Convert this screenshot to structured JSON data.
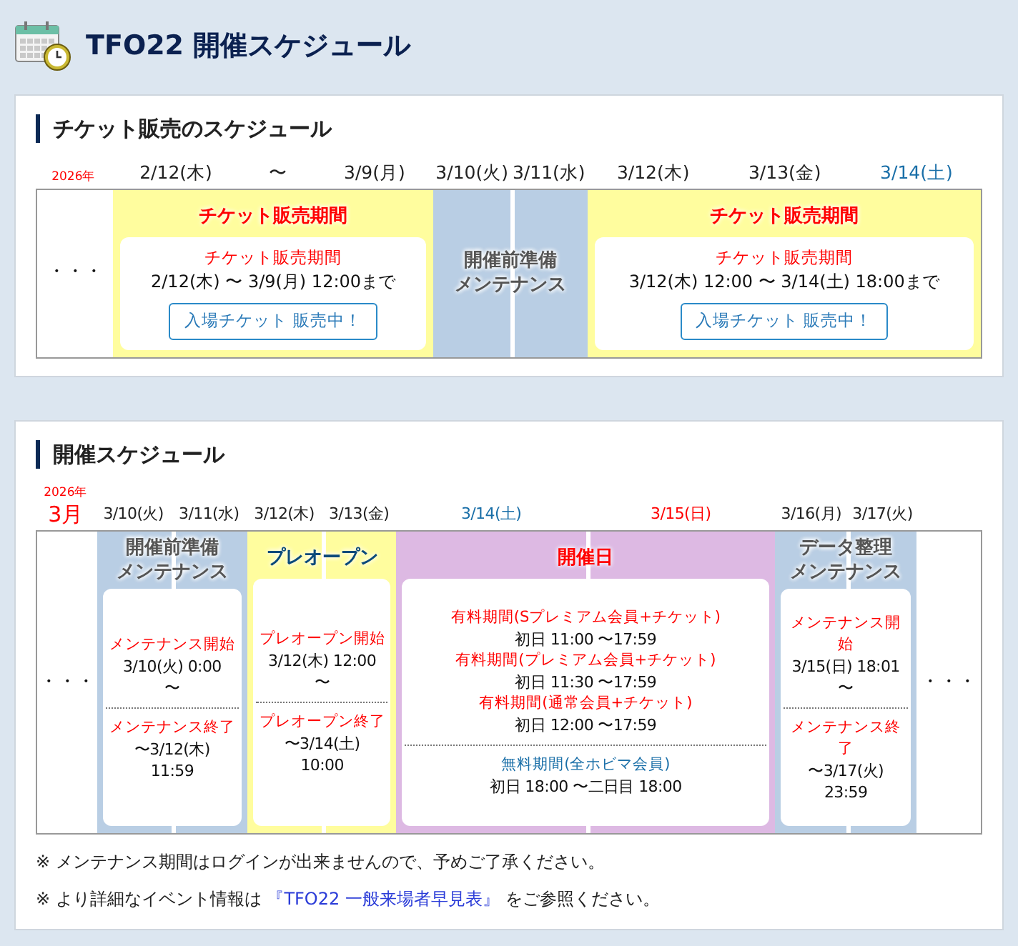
{
  "page_title": "TFO22 開催スケジュール",
  "sections": [
    {
      "title": "チケット販売のスケジュール",
      "year": "2026年",
      "periods": [
        {
          "kind": "ellipsis",
          "text": "・・・"
        },
        {
          "kind": "sale",
          "heading": [
            "チケット販売期間"
          ],
          "dates": [
            {
              "text": "2/12(木)",
              "color": "#222222"
            },
            {
              "text": "〜",
              "color": "#222222"
            },
            {
              "text": "3/9(月)",
              "color": "#222222"
            }
          ],
          "card": {
            "groups": [
              {
                "entries": [
                  {
                    "label": "チケット販売期間",
                    "color": "#ff0000",
                    "lines": [
                      "2/12(木) 〜 3/9(月) 12:00まで"
                    ]
                  }
                ]
              }
            ],
            "button": "入場チケット 販売中！"
          }
        },
        {
          "kind": "maintenance",
          "heading": [
            "開催前準備",
            "メンテナンス"
          ],
          "dates": [
            {
              "text": "3/10(火)",
              "color": "#222222"
            },
            {
              "text": "3/11(水)",
              "color": "#222222"
            }
          ]
        },
        {
          "kind": "sale",
          "heading": [
            "チケット販売期間"
          ],
          "dates": [
            {
              "text": "3/12(木)",
              "color": "#222222"
            },
            {
              "text": "3/13(金)",
              "color": "#222222"
            },
            {
              "text": "3/14(土)",
              "color": "#1a6fa8"
            }
          ],
          "card": {
            "groups": [
              {
                "entries": [
                  {
                    "label": "チケット販売期間",
                    "color": "#ff0000",
                    "lines": [
                      "3/12(木) 12:00 〜 3/14(土) 18:00まで"
                    ]
                  }
                ]
              }
            ],
            "button": "入場チケット 販売中！"
          }
        }
      ]
    },
    {
      "title": "開催スケジュール",
      "year": "2026年",
      "month": "3月",
      "periods": [
        {
          "kind": "ellipsis",
          "text": "・・・"
        },
        {
          "kind": "maintenance",
          "heading": [
            "開催前準備",
            "メンテナンス"
          ],
          "dates": [
            {
              "text": "3/10(火)",
              "color": "#222222"
            },
            {
              "text": "3/11(水)",
              "color": "#222222"
            }
          ],
          "card": {
            "groups": [
              {
                "entries": [
                  {
                    "label": "メンテナンス開始",
                    "color": "#ff0000",
                    "lines": [
                      "3/10(火) 0:00",
                      "〜"
                    ]
                  }
                ]
              },
              {
                "entries": [
                  {
                    "label": "メンテナンス終了",
                    "color": "#ff0000",
                    "lines": [
                      "〜3/12(木)",
                      "11:59"
                    ]
                  }
                ]
              }
            ]
          }
        },
        {
          "kind": "preopen",
          "heading": [
            "プレオープン"
          ],
          "dates": [
            {
              "text": "3/12(木)",
              "color": "#222222"
            },
            {
              "text": "3/13(金)",
              "color": "#222222"
            }
          ],
          "card": {
            "groups": [
              {
                "entries": [
                  {
                    "label": "プレオープン開始",
                    "color": "#ff0000",
                    "lines": [
                      "3/12(木) 12:00",
                      "〜"
                    ]
                  }
                ]
              },
              {
                "entries": [
                  {
                    "label": "プレオープン終了",
                    "color": "#ff0000",
                    "lines": [
                      "〜3/14(土)",
                      "10:00"
                    ]
                  }
                ]
              }
            ]
          }
        },
        {
          "kind": "event",
          "heading": [
            "開催日"
          ],
          "dates": [
            {
              "text": "3/14(土)",
              "color": "#1a6fa8"
            },
            {
              "text": "3/15(日)",
              "color": "#ff0000"
            }
          ],
          "card": {
            "groups": [
              {
                "entries": [
                  {
                    "label": "有料期間(Sプレミアム会員+チケット)",
                    "color": "#ff0000",
                    "lines": [
                      "初日 11:00 〜17:59"
                    ]
                  },
                  {
                    "label": "有料期間(プレミアム会員+チケット)",
                    "color": "#ff0000",
                    "lines": [
                      "初日 11:30 〜17:59"
                    ]
                  },
                  {
                    "label": "有料期間(通常会員+チケット)",
                    "color": "#ff0000",
                    "lines": [
                      "初日 12:00 〜17:59"
                    ]
                  }
                ]
              },
              {
                "entries": [
                  {
                    "label": "無料期間(全ホビマ会員)",
                    "color": "#1a6fa8",
                    "lines": [
                      "初日 18:00 〜二日目 18:00"
                    ]
                  }
                ]
              }
            ]
          }
        },
        {
          "kind": "maintenance",
          "heading": [
            "データ整理",
            "メンテナンス"
          ],
          "dates": [
            {
              "text": "3/16(月)",
              "color": "#222222"
            },
            {
              "text": "3/17(火)",
              "color": "#222222"
            }
          ],
          "card": {
            "groups": [
              {
                "entries": [
                  {
                    "label": "メンテナンス開始",
                    "color": "#ff0000",
                    "lines": [
                      "3/15(日) 18:01",
                      "〜"
                    ]
                  }
                ]
              },
              {
                "entries": [
                  {
                    "label": "メンテナンス終了",
                    "color": "#ff0000",
                    "lines": [
                      "〜3/17(火)",
                      "23:59"
                    ]
                  }
                ]
              }
            ]
          }
        },
        {
          "kind": "ellipsis",
          "text": "・・・"
        }
      ],
      "notes": [
        {
          "text": "※ メンテナンス期間はログインが出来ませんので、予めご了承ください。"
        },
        {
          "text": "※ より詳細なイベント情報は",
          "link": "『TFO22 一般来場者早見表』",
          "after": "をご参照ください。"
        }
      ]
    }
  ]
}
